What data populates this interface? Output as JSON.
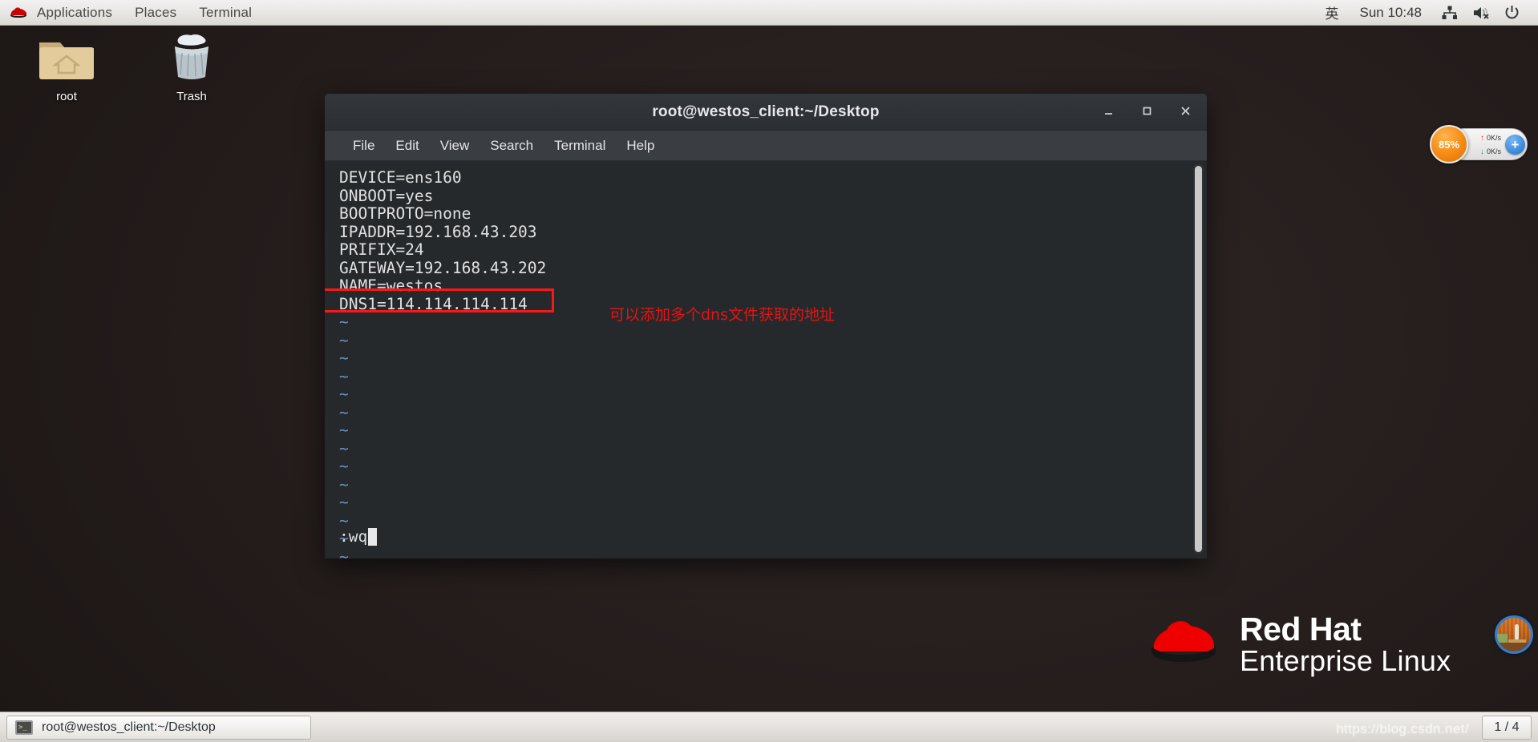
{
  "top_panel": {
    "logo_icon": "redhat-logo-icon",
    "menus": [
      {
        "label": "Applications"
      },
      {
        "label": "Places"
      },
      {
        "label": "Terminal"
      }
    ],
    "input_method": "英",
    "clock": "Sun 10:48",
    "tray": [
      {
        "name": "network-icon"
      },
      {
        "name": "volume-muted-icon"
      },
      {
        "name": "power-icon"
      }
    ]
  },
  "desktop_icons": [
    {
      "label": "root",
      "icon": "home-folder-icon"
    },
    {
      "label": "Trash",
      "icon": "trash-full-icon"
    }
  ],
  "terminal": {
    "title": "root@westos_client:~/Desktop",
    "window_buttons": {
      "minimize": "–",
      "maximize": "❐",
      "close": "✕"
    },
    "menubar": [
      {
        "label": "File"
      },
      {
        "label": "Edit"
      },
      {
        "label": "View"
      },
      {
        "label": "Search"
      },
      {
        "label": "Terminal"
      },
      {
        "label": "Help"
      }
    ],
    "content_lines": [
      "DEVICE=ens160",
      "ONBOOT=yes",
      "BOOTPROTO=none",
      "IPADDR=192.168.43.203",
      "PRIFIX=24",
      "GATEWAY=192.168.43.202",
      "NAME=westos",
      "DNS1=114.114.114.114"
    ],
    "tilde_count": 15,
    "command_line": ":wq",
    "highlighted_line": "DNS1=114.114.114.114",
    "annotation": "可以添加多个dns文件获取的地址",
    "annotation_color": "#e81212",
    "highlight_color": "#f81818"
  },
  "netspeed_widget": {
    "percent": "85%",
    "upload_rate": "0K/s",
    "download_rate": "0K/s",
    "up_arrow": "↑",
    "down_arrow": "↓",
    "add_button": "+",
    "accent_color": "#f58a12"
  },
  "branding": {
    "line1": "Red Hat",
    "line2": "Enterprise Linux",
    "logo_icon": "redhat-fedora-icon",
    "logo_color": "#ee0000"
  },
  "taskbar": {
    "task_label": "root@westos_client:~/Desktop",
    "task_icon": "terminal-icon",
    "terminal_prompt_glyph": ">_",
    "workspace": "1 / 4"
  },
  "watermark": "https://blog.csdn.net/"
}
